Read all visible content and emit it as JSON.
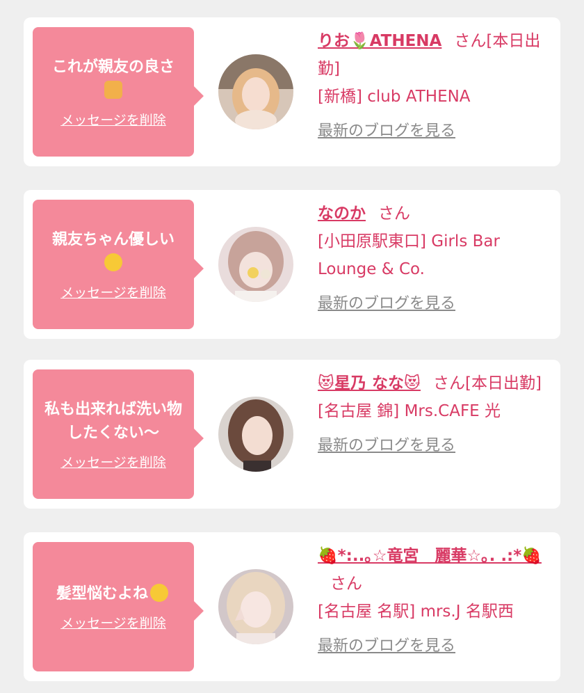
{
  "colors": {
    "card_bg": "#ffffff",
    "bubble": "#f4899a",
    "accent": "#d83a64",
    "link_gray": "#8a8a8a",
    "page_bg": "#efefef"
  },
  "cards": [
    {
      "message": "これが親友の良さ",
      "message_icon": "thumbs-up-icon",
      "delete_label": "メッセージを削除",
      "name": "りお🌷ATHENA",
      "honorific": "さん[本日出勤]",
      "store": "[新橋] club ATHENA",
      "blog_label": "最新のブログを見る"
    },
    {
      "message": "親友ちゃん優しい",
      "message_icon": "rolling-laugh-icon",
      "delete_label": "メッセージを削除",
      "name": "なのか",
      "honorific": "さん",
      "store": "[小田原駅東口] Girls Bar Lounge & Co.",
      "blog_label": "最新のブログを見る"
    },
    {
      "message": "私も出来れば洗い物したくない〜",
      "delete_label": "メッセージを削除",
      "name": "😻星乃 なな😻",
      "honorific": "さん[本日出勤]",
      "store": "[名古屋 錦] Mrs.CAFE 光",
      "blog_label": "最新のブログを見る"
    },
    {
      "message": "髪型悩むよね",
      "message_icon": "sweat-smile-icon",
      "delete_label": "メッセージを削除",
      "name": "🍓*:..｡☆竜宮　麗華☆｡. .:*🍓",
      "honorific": "さん",
      "store": "[名古屋 名駅] mrs.J 名駅西",
      "blog_label": "最新のブログを見る"
    }
  ]
}
